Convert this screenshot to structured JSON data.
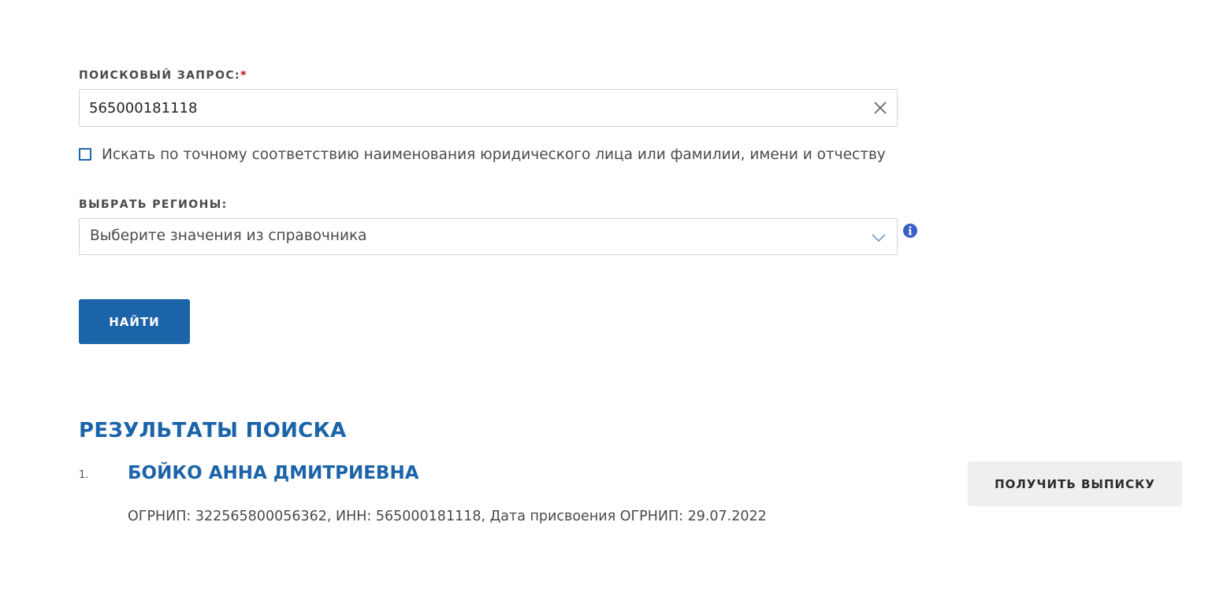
{
  "search": {
    "label": "ПОИСКОВЫЙ ЗАПРОС:",
    "required_mark": "*",
    "value": "565000181118",
    "clear_icon": "close-icon"
  },
  "exact_match": {
    "checked": false,
    "label": "Искать по точному соответствию наименования юридического лица или фамилии, имени и отчеству"
  },
  "regions": {
    "label": "ВЫБРАТЬ РЕГИОНЫ:",
    "placeholder": "Выберите значения из справочника",
    "dropdown_icon": "chevron-down-icon",
    "info_icon": "info-icon"
  },
  "find_button": {
    "label": "НАЙТИ"
  },
  "results": {
    "title": "РЕЗУЛЬТАТЫ ПОИСКА",
    "items": [
      {
        "index": "1.",
        "name": "БОЙКО АННА ДМИТРИЕВНА",
        "details": "ОГРНИП: 322565800056362, ИНН: 565000181118, Дата присвоения ОГРНИП: 29.07.2022",
        "action_label": "ПОЛУЧИТЬ ВЫПИСКУ"
      }
    ]
  },
  "colors": {
    "accent": "#1b64a9",
    "required": "#d0021b",
    "secondary_button": "#efefef",
    "border": "#cfd3d8",
    "info_icon": "#3a5fc8"
  }
}
